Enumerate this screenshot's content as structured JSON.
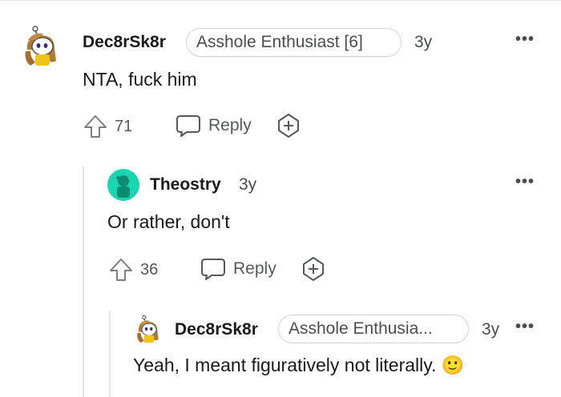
{
  "comments": [
    {
      "username": "Dec8rSk8r",
      "flair": "Asshole Enthusiast [6]",
      "time": "3y",
      "body": "NTA, fuck him",
      "votes": "71",
      "reply_label": "Reply",
      "more_icon": "more-dots-icon"
    },
    {
      "username": "Theostry",
      "time": "3y",
      "body": "Or rather, don't",
      "votes": "36",
      "reply_label": "Reply",
      "avatar_color": "#19d6b0"
    },
    {
      "username": "Dec8rSk8r",
      "flair": "Asshole Enthusia...",
      "time": "3y",
      "body": "Yeah, I meant figuratively not literally. 🙂"
    }
  ],
  "icons": {
    "upvote": "upvote-arrow-icon",
    "reply": "speech-bubble-icon",
    "award": "add-award-icon",
    "more": "more-dots-icon"
  }
}
